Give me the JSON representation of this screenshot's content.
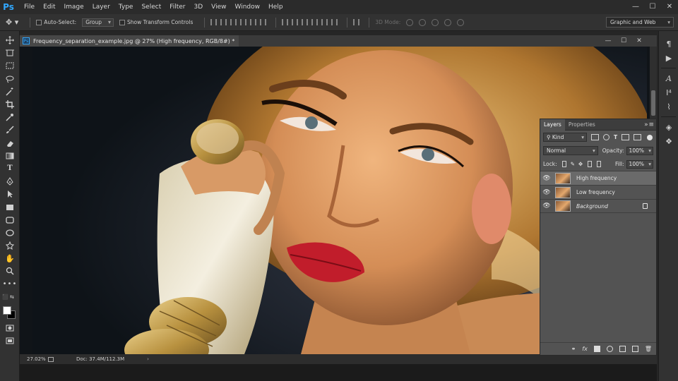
{
  "app": {
    "logo": "Ps"
  },
  "menu": [
    "File",
    "Edit",
    "Image",
    "Layer",
    "Type",
    "Select",
    "Filter",
    "3D",
    "View",
    "Window",
    "Help"
  ],
  "window_controls": {
    "minimize": "—",
    "maximize": "☐",
    "close": "✕"
  },
  "options": {
    "auto_select_label": "Auto-Select:",
    "auto_select_value": "Group",
    "show_transform_label": "Show Transform Controls",
    "mode3d_label": "3D Mode:",
    "workspace": "Graphic and Web"
  },
  "document": {
    "tab_title": "Frequency_separation_example.jpg @ 27% (High frequency, RGB/8#) *",
    "zoom": "27.02%",
    "doc_size": "Doc: 37.4M/112.3M"
  },
  "layers_panel": {
    "tabs": [
      "Layers",
      "Properties"
    ],
    "filter_kind": "Kind",
    "blend_mode": "Normal",
    "opacity_label": "Opacity:",
    "opacity_value": "100%",
    "lock_label": "Lock:",
    "fill_label": "Fill:",
    "fill_value": "100%",
    "layers": [
      {
        "name": "High frequency",
        "selected": true,
        "locked": false
      },
      {
        "name": "Low frequency",
        "selected": false,
        "locked": false
      },
      {
        "name": "Background",
        "selected": false,
        "locked": true
      }
    ],
    "footer_fx": "fx"
  },
  "colors": {
    "foreground": "#ffffff",
    "background": "#000000",
    "accent": "#31a8ff"
  },
  "icons": {
    "tools": [
      "move-icon",
      "artboard-icon",
      "marquee-icon",
      "lasso-icon",
      "magic-wand-icon",
      "crop-icon",
      "eyedropper-icon",
      "brush-icon",
      "eraser-icon",
      "gradient-icon",
      "text-icon",
      "pen-icon",
      "path-select-icon",
      "rectangle-icon",
      "rounded-rect-icon",
      "ellipse-icon",
      "custom-shape-icon",
      "hand-icon",
      "zoom-icon",
      "more-tools-icon"
    ]
  }
}
